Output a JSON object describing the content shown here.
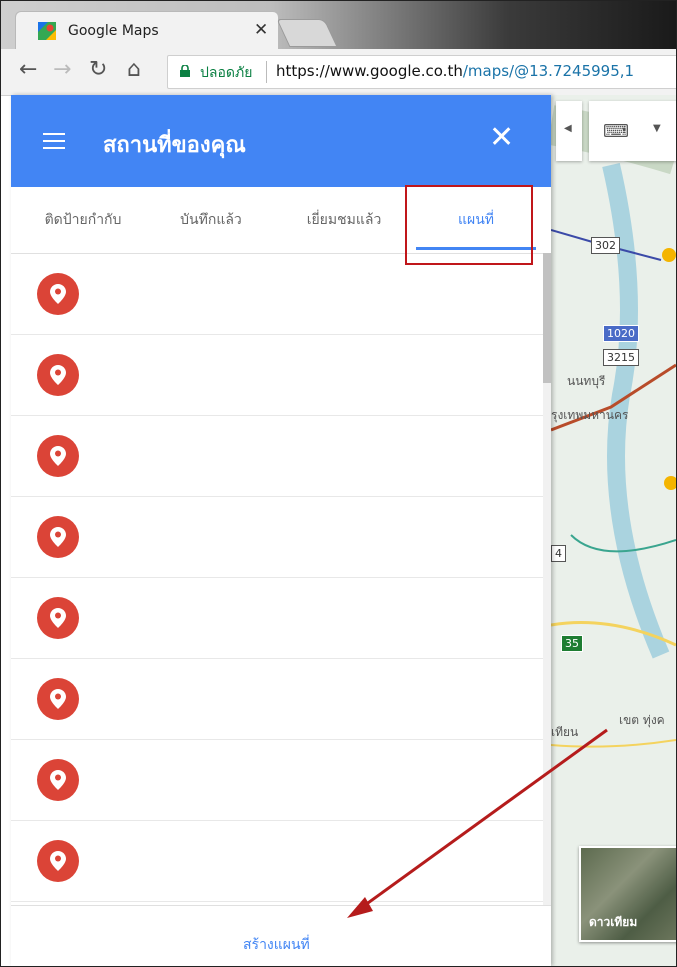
{
  "browser": {
    "tab_title": "Google Maps",
    "secure_label": "ปลอดภัย",
    "url_scheme_host": "https://www.google.co.th",
    "url_path": "/maps/@13.7245995,1"
  },
  "panel": {
    "title": "สถานที่ของคุณ",
    "tabs": [
      {
        "label": "ติดป้ายกำกับ"
      },
      {
        "label": "บันทึกแล้ว"
      },
      {
        "label": "เยี่ยมชมแล้ว"
      },
      {
        "label": "แผนที่"
      }
    ],
    "active_tab": "แผนที่",
    "places": [
      "",
      "",
      "",
      "",
      "",
      "",
      "",
      ""
    ],
    "create_map_label": "สร้างแผนที่"
  },
  "map": {
    "labels": {
      "shield_302": "302",
      "shield_1020": "1020",
      "shield_3215": "3215",
      "nonthaburi": "นนทบุรี",
      "bangkok": "รุงเทพมหานคร",
      "shield_4": "4",
      "shield_35": "35",
      "district": "เขต ทุ่งค",
      "thian": "เทียน"
    },
    "satellite_label": "ดาวเทียม"
  },
  "colors": {
    "header_blue": "#4285f4",
    "pin_red": "#db4437",
    "annotation_red": "#c0161a"
  }
}
